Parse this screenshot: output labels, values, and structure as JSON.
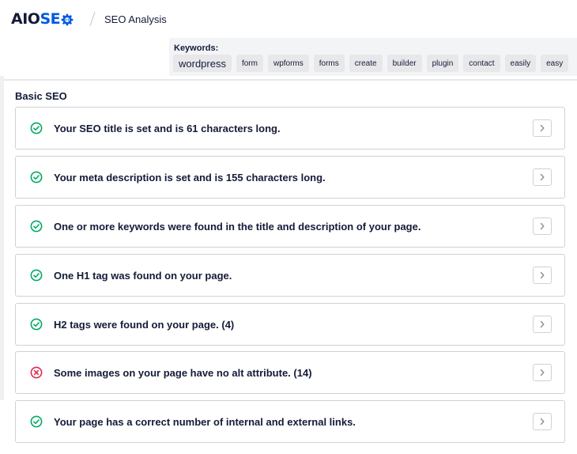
{
  "brand": {
    "logo_part1": "AIO",
    "logo_part2": "SE",
    "logo_part3": "O",
    "primary_color": "#005ae0",
    "dark_color": "#141b38"
  },
  "header": {
    "separator": "/",
    "title": "SEO Analysis"
  },
  "keywords": {
    "label": "Keywords:",
    "items": [
      "wordpress",
      "form",
      "wpforms",
      "forms",
      "create",
      "builder",
      "plugin",
      "contact",
      "easily",
      "easy"
    ]
  },
  "section": {
    "title": "Basic SEO",
    "items": [
      {
        "status": "pass",
        "text": "Your SEO title is set and is 61 characters long."
      },
      {
        "status": "pass",
        "text": "Your meta description is set and is 155 characters long."
      },
      {
        "status": "pass",
        "text": "One or more keywords were found in the title and description of your page."
      },
      {
        "status": "pass",
        "text": "One H1 tag was found on your page."
      },
      {
        "status": "pass",
        "text": "H2 tags were found on your page. (4)"
      },
      {
        "status": "fail",
        "text": "Some images on your page have no alt attribute. (14)"
      },
      {
        "status": "pass",
        "text": "Your page has a correct number of internal and external links."
      }
    ]
  },
  "colors": {
    "pass": "#00aa63",
    "fail": "#df2a4a"
  },
  "icons": {
    "pass": "check-circle-icon",
    "fail": "x-circle-icon",
    "expand": "chevron-right-icon",
    "logo": "gear-icon"
  }
}
